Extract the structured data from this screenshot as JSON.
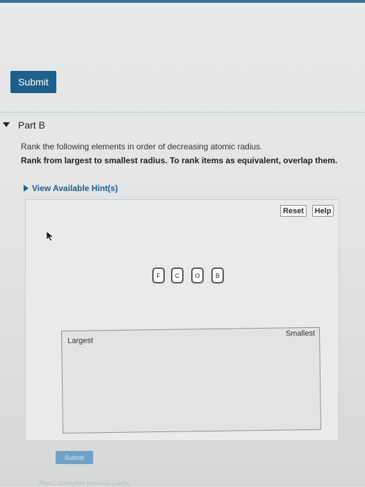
{
  "top_submit": {
    "label": "Submit"
  },
  "part": {
    "title": "Part B"
  },
  "question": {
    "instruction": "Rank the following elements in order of decreasing atomic radius.",
    "rule": "Rank from largest to smallest radius. To rank items as equivalent, overlap them.",
    "hint_link": "View Available Hint(s)"
  },
  "controls": {
    "reset": "Reset",
    "help": "Help"
  },
  "items": [
    "F",
    "C",
    "O",
    "B"
  ],
  "dropzone": {
    "left_label": "Largest",
    "right_label": "Smallest"
  },
  "bottom_submit": {
    "label": "Submit"
  },
  "next_part": {
    "label": "Part C",
    "text": "Complete previous part(s)"
  },
  "colors": {
    "accent": "#1f5f8b",
    "disabled_button": "#6fa3c6"
  }
}
